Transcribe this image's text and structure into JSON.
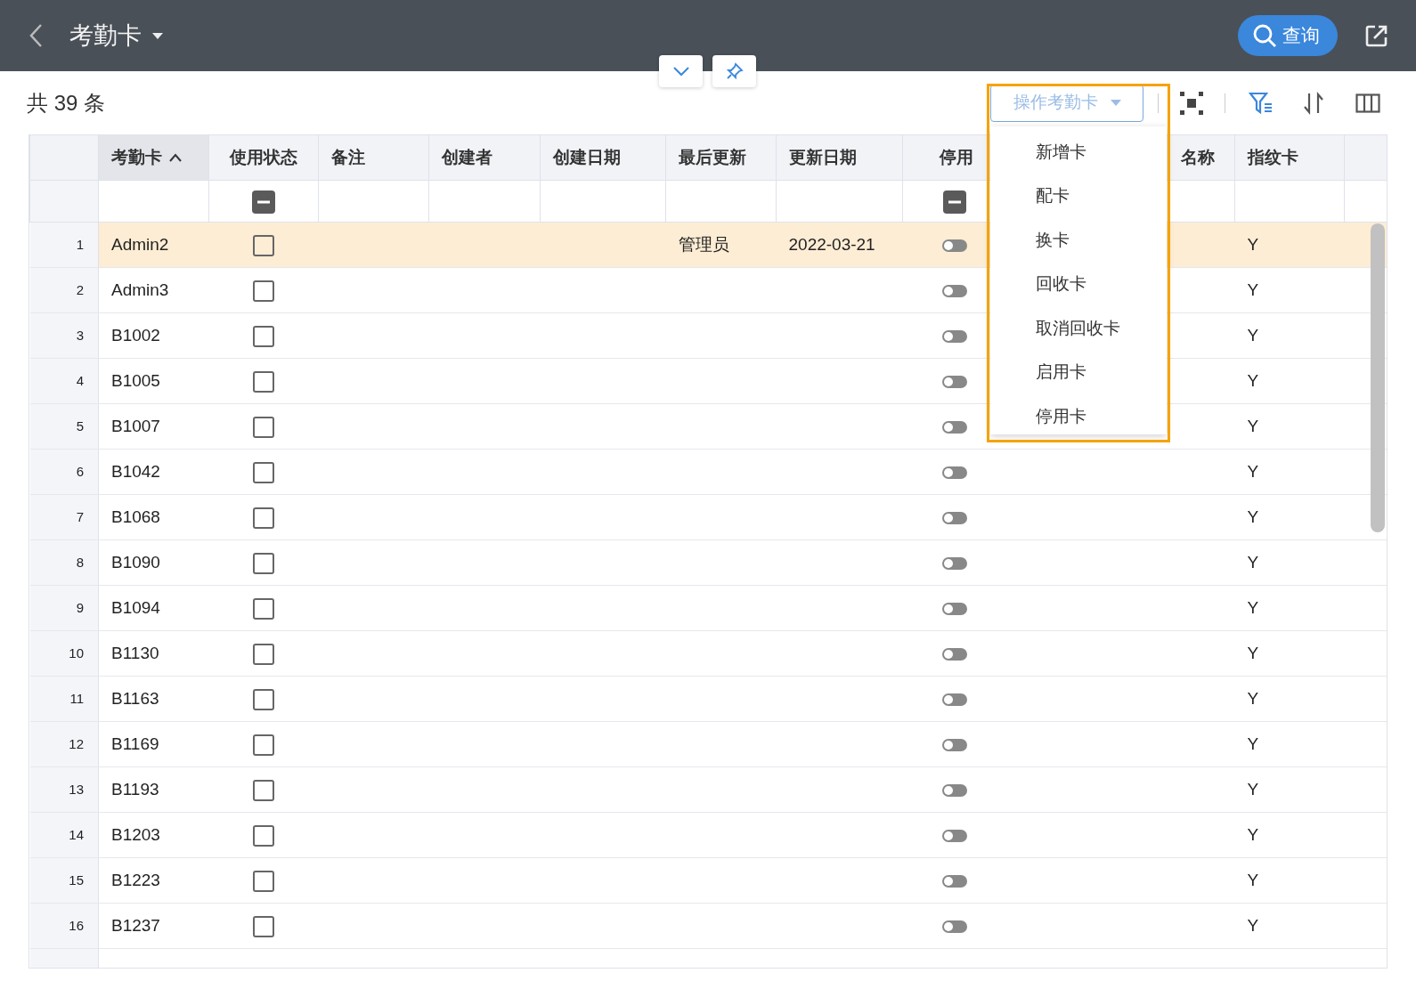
{
  "header": {
    "title": "考勤卡",
    "search_button": "查询"
  },
  "record_count": "共 39 条",
  "action_dropdown": {
    "label": "操作考勤卡",
    "expanded": true,
    "highlighted": true,
    "items": [
      "新增卡",
      "配卡",
      "换卡",
      "回收卡",
      "取消回收卡",
      "启用卡",
      "停用卡"
    ]
  },
  "table": {
    "columns": [
      {
        "label": "考勤卡",
        "kind": "text",
        "sorted_ascending": true
      },
      {
        "label": "使用状态",
        "kind": "checkbox",
        "filter_indeterminate": true
      },
      {
        "label": "备注",
        "kind": "text"
      },
      {
        "label": "创建者",
        "kind": "text"
      },
      {
        "label": "创建日期",
        "kind": "text"
      },
      {
        "label": "最后更新",
        "kind": "text"
      },
      {
        "label": "更新日期",
        "kind": "text"
      },
      {
        "label": "停用",
        "kind": "toggle",
        "filter_indeterminate": true
      },
      {
        "label": "名称",
        "kind": "text"
      },
      {
        "label": "指纹卡",
        "kind": "text"
      }
    ],
    "rows": [
      {
        "number": "1",
        "selected": true,
        "cells": [
          "Admin2",
          false,
          null,
          null,
          null,
          "管理员",
          "2022-03-21",
          false,
          null,
          "Y"
        ]
      },
      {
        "number": "2",
        "selected": false,
        "cells": [
          "Admin3",
          false,
          null,
          null,
          null,
          null,
          null,
          false,
          null,
          "Y"
        ]
      },
      {
        "number": "3",
        "selected": false,
        "cells": [
          "B1002",
          false,
          null,
          null,
          null,
          null,
          null,
          false,
          null,
          "Y"
        ]
      },
      {
        "number": "4",
        "selected": false,
        "cells": [
          "B1005",
          false,
          null,
          null,
          null,
          null,
          null,
          false,
          null,
          "Y"
        ]
      },
      {
        "number": "5",
        "selected": false,
        "cells": [
          "B1007",
          false,
          null,
          null,
          null,
          null,
          null,
          false,
          null,
          "Y"
        ]
      },
      {
        "number": "6",
        "selected": false,
        "cells": [
          "B1042",
          false,
          null,
          null,
          null,
          null,
          null,
          false,
          null,
          "Y"
        ]
      },
      {
        "number": "7",
        "selected": false,
        "cells": [
          "B1068",
          false,
          null,
          null,
          null,
          null,
          null,
          false,
          null,
          "Y"
        ]
      },
      {
        "number": "8",
        "selected": false,
        "cells": [
          "B1090",
          false,
          null,
          null,
          null,
          null,
          null,
          false,
          null,
          "Y"
        ]
      },
      {
        "number": "9",
        "selected": false,
        "cells": [
          "B1094",
          false,
          null,
          null,
          null,
          null,
          null,
          false,
          null,
          "Y"
        ]
      },
      {
        "number": "10",
        "selected": false,
        "cells": [
          "B1130",
          false,
          null,
          null,
          null,
          null,
          null,
          false,
          null,
          "Y"
        ]
      },
      {
        "number": "11",
        "selected": false,
        "cells": [
          "B1163",
          false,
          null,
          null,
          null,
          null,
          null,
          false,
          null,
          "Y"
        ]
      },
      {
        "number": "12",
        "selected": false,
        "cells": [
          "B1169",
          false,
          null,
          null,
          null,
          null,
          null,
          false,
          null,
          "Y"
        ]
      },
      {
        "number": "13",
        "selected": false,
        "cells": [
          "B1193",
          false,
          null,
          null,
          null,
          null,
          null,
          false,
          null,
          "Y"
        ]
      },
      {
        "number": "14",
        "selected": false,
        "cells": [
          "B1203",
          false,
          null,
          null,
          null,
          null,
          null,
          false,
          null,
          "Y"
        ]
      },
      {
        "number": "15",
        "selected": false,
        "cells": [
          "B1223",
          false,
          null,
          null,
          null,
          null,
          null,
          false,
          null,
          "Y"
        ]
      },
      {
        "number": "16",
        "selected": false,
        "cells": [
          "B1237",
          false,
          null,
          null,
          null,
          null,
          null,
          false,
          null,
          "Y"
        ]
      }
    ]
  }
}
